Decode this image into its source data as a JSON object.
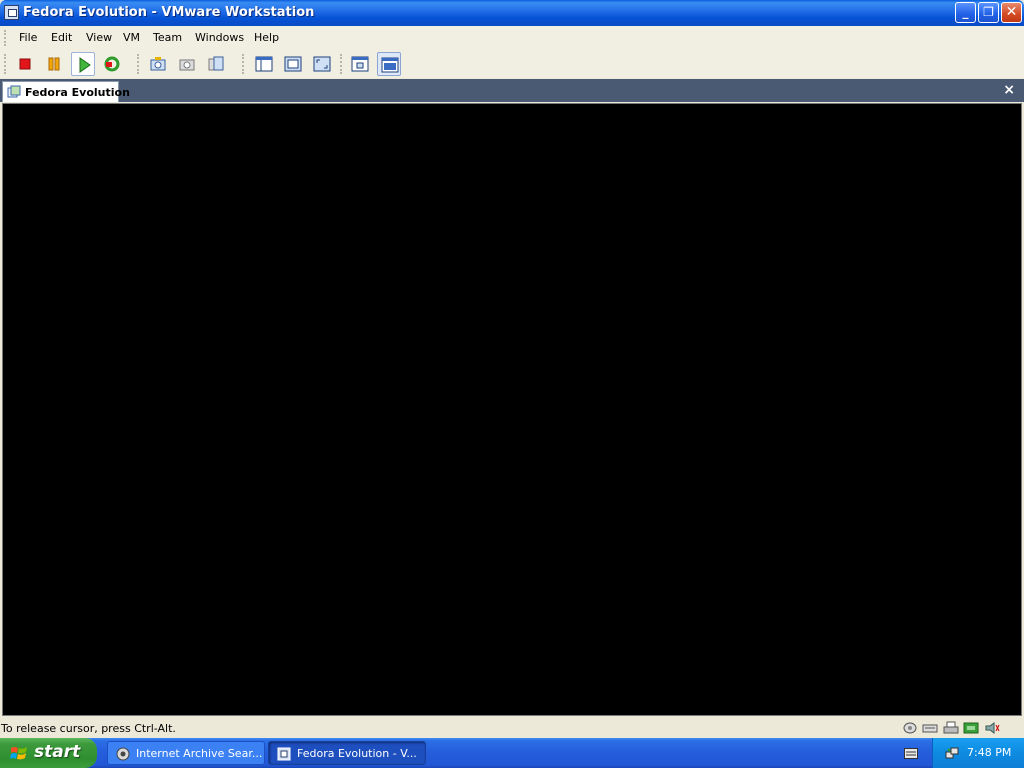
{
  "window": {
    "title": "Fedora Evolution - VMware Workstation",
    "minimize": "_",
    "restore": "❐",
    "close": "✕"
  },
  "menu": [
    "File",
    "Edit",
    "View",
    "VM",
    "Team",
    "Windows",
    "Help"
  ],
  "vm_tab": {
    "label": "Fedora Evolution",
    "close": "×"
  },
  "status_bar": {
    "text": "To release cursor, press Ctrl-Alt."
  },
  "taskbar": {
    "start_label": "start",
    "tasks": [
      {
        "label": "Internet Archive Sear..."
      },
      {
        "label": "Fedora Evolution - V..."
      }
    ],
    "clock": "7:48 PM"
  },
  "colors": {
    "titlebar": "#0a5fdc",
    "console": "#000000",
    "tabbar": "#4a5a73",
    "taskbar": "#245ddb",
    "start": "#3c9a3c"
  }
}
